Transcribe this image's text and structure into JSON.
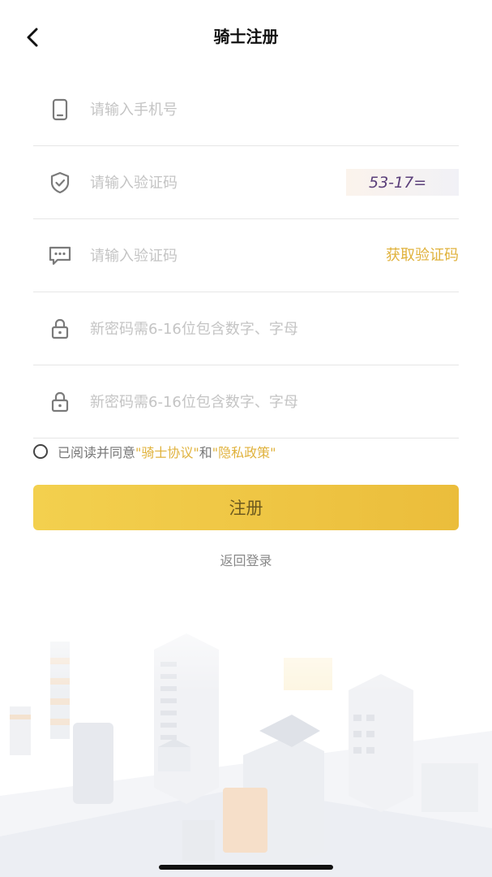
{
  "nav": {
    "title": "骑士注册",
    "back_icon": "chevron-left-icon"
  },
  "form": {
    "phone": {
      "placeholder": "请输入手机号",
      "icon": "phone-icon"
    },
    "image_code": {
      "placeholder": "请输入验证码",
      "icon": "shield-check-icon",
      "captcha_text": "53-17="
    },
    "sms_code": {
      "placeholder": "请输入验证码",
      "icon": "message-icon",
      "action_label": "获取验证码"
    },
    "password": {
      "placeholder": "新密码需6-16位包含数字、字母",
      "icon": "lock-icon"
    },
    "password_confirm": {
      "placeholder": "新密码需6-16位包含数字、字母",
      "icon": "lock-icon"
    }
  },
  "agreement": {
    "prefix": "已阅读并同意",
    "rider_agreement": "\"骑士协议\"",
    "and": "和",
    "privacy_policy": "\"隐私政策\"",
    "checked": false
  },
  "submit_label": "注册",
  "back_to_login": "返回登录",
  "colors": {
    "accent": "#e0b23c",
    "button_start": "#f3d04e",
    "button_end": "#ebbd3b",
    "placeholder": "#c4c4c4"
  }
}
